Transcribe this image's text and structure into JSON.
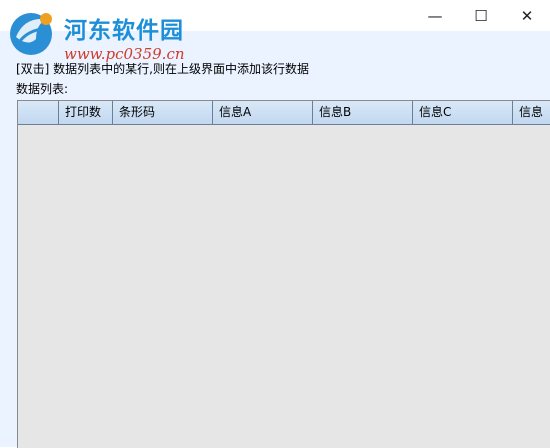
{
  "window": {
    "minimize_glyph": "—",
    "maximize_glyph": "☐",
    "close_glyph": "✕"
  },
  "watermark": {
    "site_name": "河东软件园",
    "url": "www.pc0359.cn"
  },
  "hint_text": "[双击] 数据列表中的某行,则在上级界面中添加该行数据",
  "list_label": "数据列表:",
  "grid": {
    "columns": [
      "",
      "打印数",
      "条形码",
      "信息A",
      "信息B",
      "信息C",
      "信息"
    ]
  }
}
